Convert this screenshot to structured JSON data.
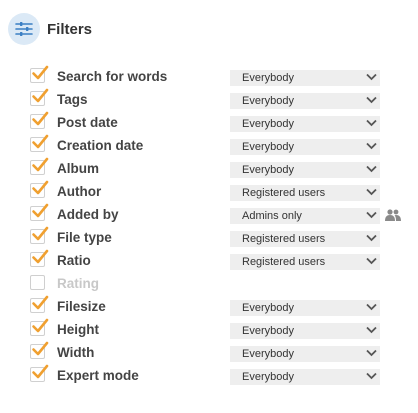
{
  "header": {
    "title": "Filters",
    "icon": "sliders-icon"
  },
  "filters": [
    {
      "label": "Search for words",
      "checked": true,
      "value": "Everybody"
    },
    {
      "label": "Tags",
      "checked": true,
      "value": "Everybody"
    },
    {
      "label": "Post date",
      "checked": true,
      "value": "Everybody"
    },
    {
      "label": "Creation date",
      "checked": true,
      "value": "Everybody"
    },
    {
      "label": "Album",
      "checked": true,
      "value": "Everybody"
    },
    {
      "label": "Author",
      "checked": true,
      "value": "Registered users"
    },
    {
      "label": "Added by",
      "checked": true,
      "value": "Admins only",
      "icon": "users-icon"
    },
    {
      "label": "File type",
      "checked": true,
      "value": "Registered users"
    },
    {
      "label": "Ratio",
      "checked": true,
      "value": "Registered users"
    },
    {
      "label": "Rating",
      "checked": false,
      "value": null
    },
    {
      "label": "Filesize",
      "checked": true,
      "value": "Everybody"
    },
    {
      "label": "Height",
      "checked": true,
      "value": "Everybody"
    },
    {
      "label": "Width",
      "checked": true,
      "value": "Everybody"
    },
    {
      "label": "Expert mode",
      "checked": true,
      "value": "Everybody"
    }
  ],
  "colors": {
    "check": "#f0a030",
    "header_icon_bg": "#dbe9f6",
    "header_icon": "#3b7fc4",
    "select_bg": "#eeeeee"
  }
}
